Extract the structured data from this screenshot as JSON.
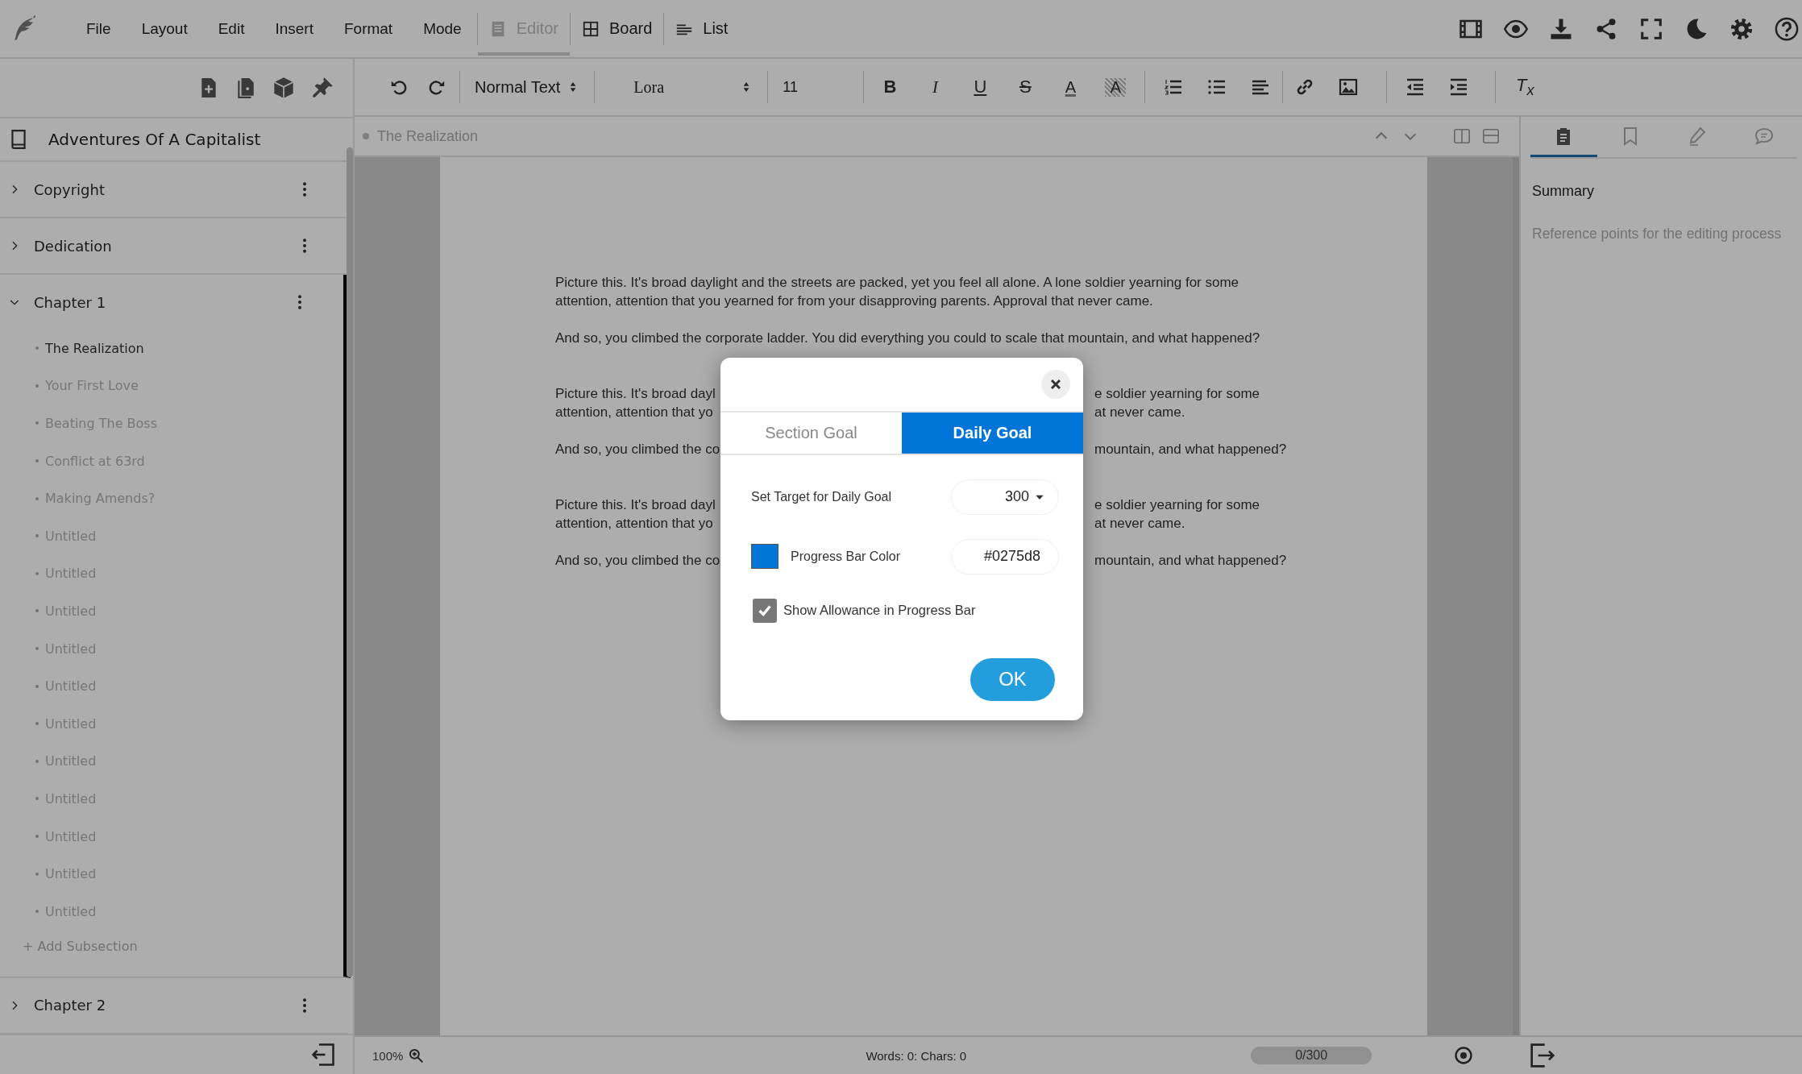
{
  "top_bar": {
    "menu": [
      "File",
      "Layout",
      "Edit",
      "Insert",
      "Format",
      "Mode"
    ],
    "view_tabs": [
      {
        "label": "Editor",
        "selected": true
      },
      {
        "label": "Board",
        "selected": false
      },
      {
        "label": "List",
        "selected": false
      }
    ]
  },
  "toolbar": {
    "paragraph_style": "Normal Text",
    "font": "Lora",
    "font_size": "11",
    "format_buttons": [
      "B",
      "I",
      "U",
      "S",
      "A",
      "A"
    ],
    "clear_format": "T$_{x}$"
  },
  "sidebar": {
    "book_title": "Adventures Of A Capitalist",
    "sections": [
      {
        "label": "Copyright",
        "expanded": false
      },
      {
        "label": "Dedication",
        "expanded": false
      },
      {
        "label": "Chapter 1",
        "expanded": true,
        "children": [
          {
            "label": "The Realization",
            "selected": true
          },
          {
            "label": "Your First Love",
            "selected": false
          },
          {
            "label": "Beating The Boss",
            "selected": false
          },
          {
            "label": "Conflict at 63rd",
            "selected": false
          },
          {
            "label": "Making Amends?",
            "selected": false
          },
          {
            "label": "Untitled",
            "selected": false
          },
          {
            "label": "Untitled",
            "selected": false
          },
          {
            "label": "Untitled",
            "selected": false
          },
          {
            "label": "Untitled",
            "selected": false
          },
          {
            "label": "Untitled",
            "selected": false
          },
          {
            "label": "Untitled",
            "selected": false
          },
          {
            "label": "Untitled",
            "selected": false
          },
          {
            "label": "Untitled",
            "selected": false
          },
          {
            "label": "Untitled",
            "selected": false
          },
          {
            "label": "Untitled",
            "selected": false
          },
          {
            "label": "Untitled",
            "selected": false
          }
        ],
        "add_label": "+ Add Subsection"
      },
      {
        "label": "Chapter 2",
        "expanded": false
      }
    ]
  },
  "editor": {
    "breadcrumb": "The Realization",
    "blocks": [
      {
        "paragraphs": [
          {
            "kind": "full",
            "lines": [
              "Picture this. It's broad daylight and the streets are packed, yet you feel all alone. A lone soldier yearning for some",
              "attention, attention that you yearned for from your disapproving parents. Approval that never came."
            ]
          },
          {
            "kind": "full",
            "lines": [
              "And so, you climbed the corporate ladder. You did everything you could to scale that mountain, and what happened?"
            ]
          }
        ]
      },
      {
        "paragraphs": [
          {
            "kind": "split",
            "left": [
              "Picture this. It's broad dayl",
              "attention, attention that yo"
            ],
            "right": [
              "e soldier yearning for some",
              "at never came."
            ]
          },
          {
            "kind": "split",
            "left": [
              "And so, you climbed the co"
            ],
            "right": [
              "mountain, and what happened?"
            ]
          }
        ]
      },
      {
        "paragraphs": [
          {
            "kind": "split",
            "left": [
              "Picture this. It's broad dayl",
              "attention, attention that yo"
            ],
            "right": [
              "e soldier yearning for some",
              "at never came."
            ]
          },
          {
            "kind": "split",
            "left": [
              "And so, you climbed the co"
            ],
            "right": [
              "mountain, and what happened?"
            ]
          }
        ]
      }
    ]
  },
  "right_panel": {
    "tabs": [
      {
        "selected": true
      },
      {
        "selected": false
      },
      {
        "selected": false
      },
      {
        "selected": false
      }
    ],
    "heading": "Summary",
    "placeholder": "Reference points for the editing process"
  },
  "status_bar": {
    "zoom": "100%",
    "counts": "Words: 0: Chars: 0",
    "goal_progress": {
      "text": "0/300",
      "level": 0
    }
  },
  "dialog": {
    "tabs": [
      {
        "label": "Section Goal",
        "selected": false
      },
      {
        "label": "Daily Goal",
        "selected": true
      }
    ],
    "target_label": "Set Target for Daily Goal",
    "target_value": "300",
    "color_label": "Progress Bar Color",
    "color_value": "#0275d8",
    "allowance": {
      "label": "Show Allowance in Progress Bar",
      "checked": true
    },
    "ok_label": "OK"
  }
}
